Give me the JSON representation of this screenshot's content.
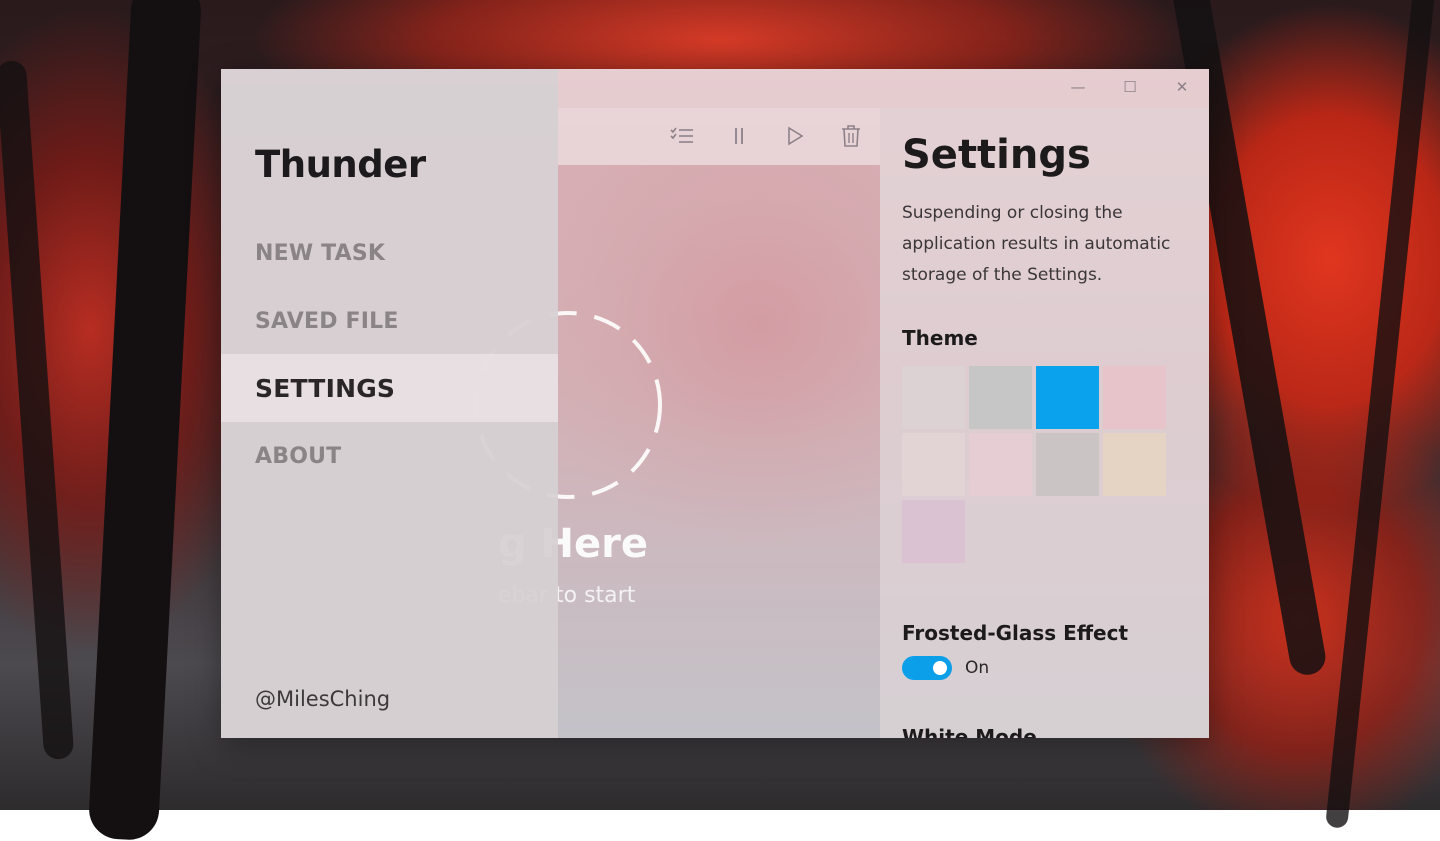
{
  "window": {
    "controls": {
      "minimize": "—",
      "maximize": "☐",
      "close": "✕"
    }
  },
  "sidebar": {
    "app_title": "Thunder",
    "items": [
      {
        "label": "NEW TASK",
        "active": false
      },
      {
        "label": "SAVED FILE",
        "active": false
      },
      {
        "label": "SETTINGS",
        "active": true
      },
      {
        "label": "ABOUT",
        "active": false
      }
    ],
    "credit": "@MilesChing"
  },
  "toolbar": {
    "icons": [
      "select-all-icon",
      "pause-icon",
      "play-icon",
      "trash-icon"
    ]
  },
  "main": {
    "empty_title": "g Here",
    "empty_subtitle": "ebar to start"
  },
  "settings": {
    "title": "Settings",
    "description": "Suspending or closing the application results in automatic storage of the Settings.",
    "theme_label": "Theme",
    "theme_colors": [
      "#dcd2d5",
      "#c2c4c6",
      "#0aa2ec",
      "#e8c2c8",
      "#e3d3d6",
      "#e6cdd3",
      "#c8c2c2",
      "#e6d4c2",
      "#d9bfd2"
    ],
    "selected_theme": 2,
    "frosted_glass_label": "Frosted-Glass Effect",
    "frosted_glass_state": "On",
    "white_mode_label": "White Mode"
  },
  "colors": {
    "accent": "#0a9fe8"
  }
}
